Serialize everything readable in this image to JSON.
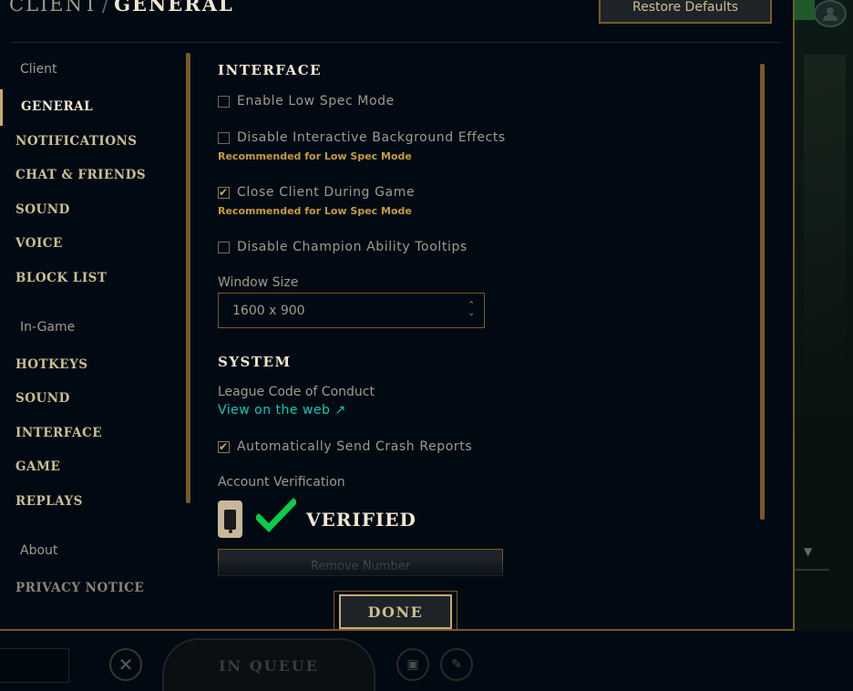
{
  "header": {
    "section": "CLIENT",
    "separator": "/",
    "current": "GENERAL",
    "restore_label": "Restore Defaults"
  },
  "nav": {
    "client_group": "Client",
    "client_items": [
      "GENERAL",
      "NOTIFICATIONS",
      "CHAT & FRIENDS",
      "SOUND",
      "VOICE",
      "BLOCK LIST"
    ],
    "ingame_group": "In-Game",
    "ingame_items": [
      "HOTKEYS",
      "SOUND",
      "INTERFACE",
      "GAME",
      "REPLAYS"
    ],
    "about_group": "About",
    "about_items": [
      "PRIVACY NOTICE"
    ],
    "active": "GENERAL"
  },
  "interface": {
    "heading": "INTERFACE",
    "options": [
      {
        "label": "Enable Low Spec Mode",
        "checked": false,
        "note": ""
      },
      {
        "label": "Disable Interactive Background Effects",
        "checked": false,
        "note": "Recommended for Low Spec Mode"
      },
      {
        "label": "Close Client During Game",
        "checked": true,
        "note": "Recommended for Low Spec Mode"
      },
      {
        "label": "Disable Champion Ability Tooltips",
        "checked": false,
        "note": ""
      }
    ],
    "window_size_label": "Window Size",
    "window_size_value": "1600 x 900"
  },
  "system": {
    "heading": "SYSTEM",
    "conduct_label": "League Code of Conduct",
    "conduct_link": "View on the web ↗",
    "crash_reports_label": "Automatically Send Crash Reports",
    "crash_reports_checked": true,
    "verification_label": "Account Verification",
    "verified_text": "VERIFIED",
    "remove_number_label": "Remove Number"
  },
  "footer": {
    "done_label": "DONE"
  },
  "background": {
    "queue_label": "IN QUEUE"
  },
  "colors": {
    "gold": "#c8aa6e",
    "gold_dark": "#785a28",
    "note_gold": "#c89b3c",
    "link_teal": "#0ac8b9",
    "verified_green": "#0acb4a"
  },
  "icons": [
    "phone-icon",
    "checkmark-icon",
    "external-link-icon",
    "close-icon",
    "select-arrows-icon",
    "avatar-icon"
  ]
}
